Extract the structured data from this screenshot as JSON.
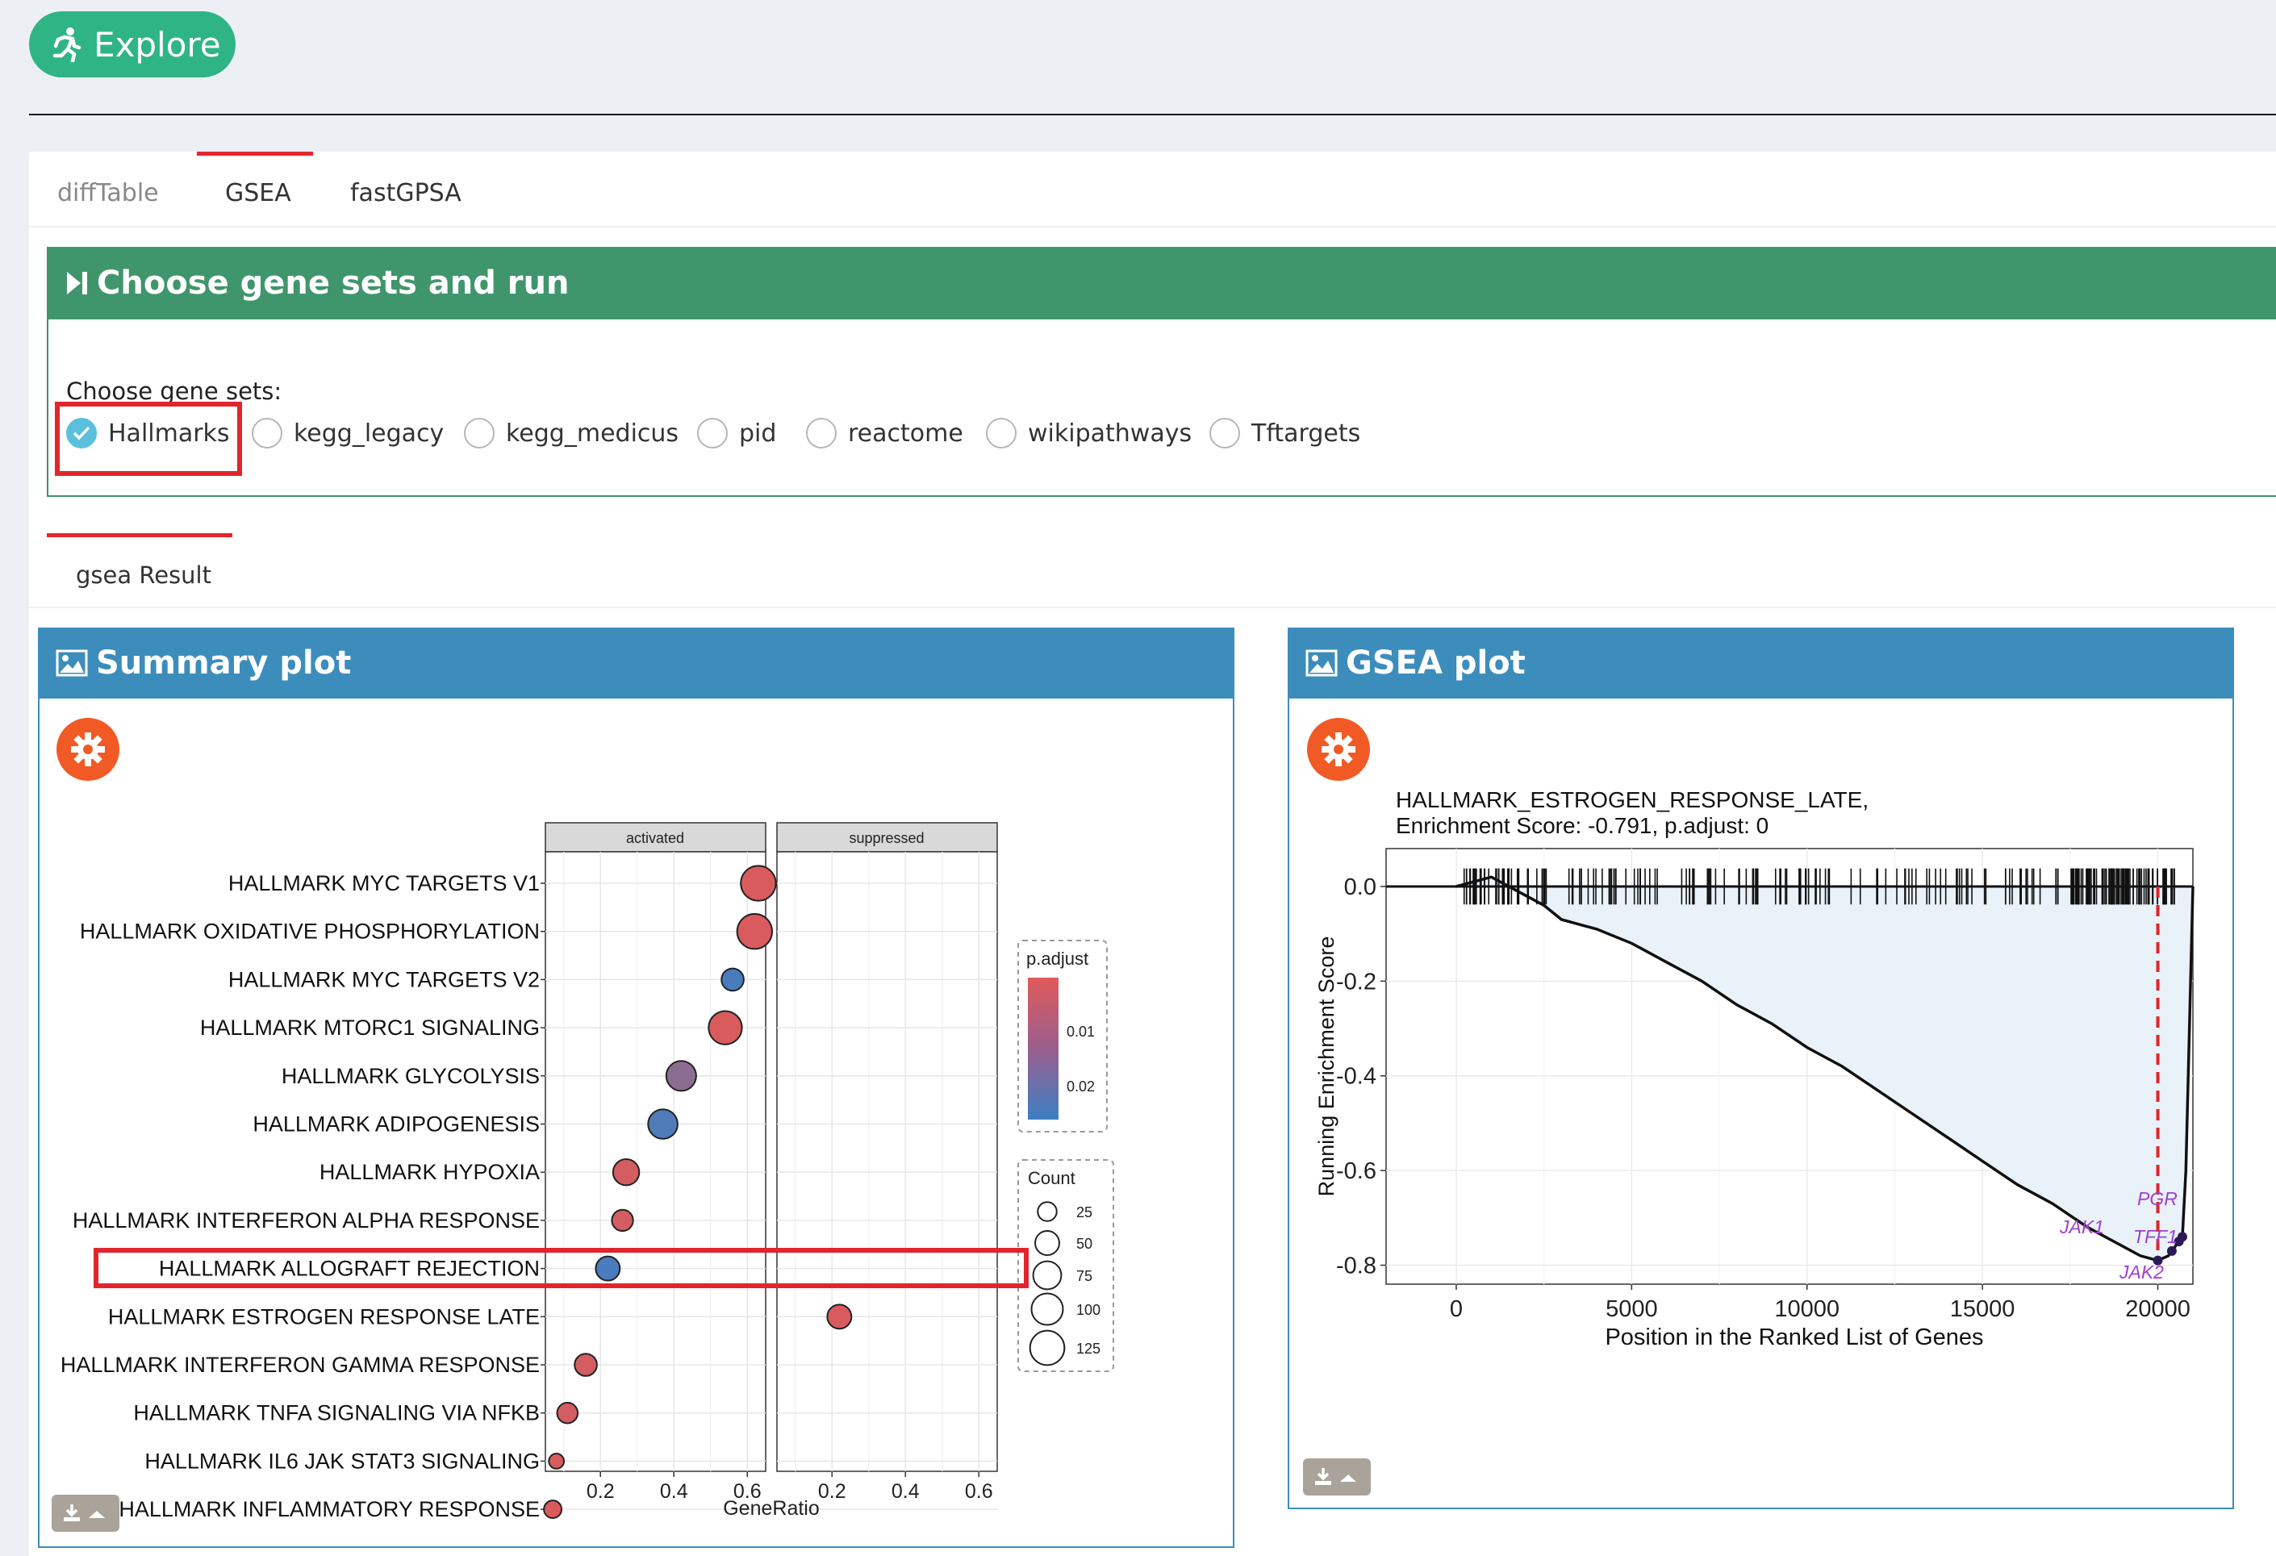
{
  "explore_button": {
    "label": "Explore",
    "icon": "running-person-icon"
  },
  "tabs": [
    {
      "label": "diffTable",
      "active": false
    },
    {
      "label": "GSEA",
      "active": true
    },
    {
      "label": "fastGPSA",
      "active": false
    }
  ],
  "choose_panel": {
    "title": "Choose gene sets and run",
    "label": "Choose gene sets:",
    "options": [
      {
        "label": "Hallmarks",
        "selected": true
      },
      {
        "label": "kegg_legacy",
        "selected": false
      },
      {
        "label": "kegg_medicus",
        "selected": false
      },
      {
        "label": "pid",
        "selected": false
      },
      {
        "label": "reactome",
        "selected": false
      },
      {
        "label": "wikipathways",
        "selected": false
      },
      {
        "label": "Tftargets",
        "selected": false
      }
    ]
  },
  "result_tab": {
    "label": "gsea Result"
  },
  "summary_card": {
    "title": "Summary plot"
  },
  "gsea_card": {
    "title": "GSEA plot"
  },
  "colors": {
    "activated_high": "#e05a5a",
    "activated_low": "#3d7fc4",
    "header_green": "#40966c",
    "header_blue": "#3c8dbc",
    "highlight_red": "#e1252c"
  },
  "chart_data": [
    {
      "type": "scatter",
      "title": "",
      "facets": [
        "activated",
        "suppressed"
      ],
      "xlabel": "GeneRatio",
      "ylabel": "",
      "x_ticks": [
        "0.2",
        "0.4",
        "0.6"
      ],
      "xlim": [
        0.05,
        0.65
      ],
      "categories": [
        "HALLMARK MYC TARGETS V1",
        "HALLMARK OXIDATIVE PHOSPHORYLATION",
        "HALLMARK MYC TARGETS V2",
        "HALLMARK MTORC1 SIGNALING",
        "HALLMARK GLYCOLYSIS",
        "HALLMARK ADIPOGENESIS",
        "HALLMARK HYPOXIA",
        "HALLMARK INTERFERON ALPHA RESPONSE",
        "HALLMARK ALLOGRAFT REJECTION",
        "HALLMARK ESTROGEN RESPONSE LATE",
        "HALLMARK INTERFERON GAMMA RESPONSE",
        "HALLMARK TNFA SIGNALING VIA NFKB",
        "HALLMARK IL6 JAK STAT3 SIGNALING",
        "HALLMARK INFLAMMATORY RESPONSE"
      ],
      "points": [
        {
          "term": "HALLMARK MYC TARGETS V1",
          "facet": "activated",
          "x": 0.63,
          "count": 130,
          "p_adjust": 0.001
        },
        {
          "term": "HALLMARK OXIDATIVE PHOSPHORYLATION",
          "facet": "activated",
          "x": 0.62,
          "count": 130,
          "p_adjust": 0.001
        },
        {
          "term": "HALLMARK MYC TARGETS V2",
          "facet": "activated",
          "x": 0.56,
          "count": 40,
          "p_adjust": 0.025
        },
        {
          "term": "HALLMARK MTORC1 SIGNALING",
          "facet": "activated",
          "x": 0.54,
          "count": 115,
          "p_adjust": 0.001
        },
        {
          "term": "HALLMARK GLYCOLYSIS",
          "facet": "activated",
          "x": 0.42,
          "count": 88,
          "p_adjust": 0.014
        },
        {
          "term": "HALLMARK ADIPOGENESIS",
          "facet": "activated",
          "x": 0.37,
          "count": 85,
          "p_adjust": 0.024
        },
        {
          "term": "HALLMARK HYPOXIA",
          "facet": "activated",
          "x": 0.27,
          "count": 62,
          "p_adjust": 0.002
        },
        {
          "term": "HALLMARK INTERFERON ALPHA RESPONSE",
          "facet": "activated",
          "x": 0.26,
          "count": 35,
          "p_adjust": 0.002
        },
        {
          "term": "HALLMARK ALLOGRAFT REJECTION",
          "facet": "activated",
          "x": 0.22,
          "count": 50,
          "p_adjust": 0.025
        },
        {
          "term": "HALLMARK ESTROGEN RESPONSE LATE",
          "facet": "suppressed",
          "x": 0.22,
          "count": 50,
          "p_adjust": 0.001
        },
        {
          "term": "HALLMARK INTERFERON GAMMA RESPONSE",
          "facet": "activated",
          "x": 0.16,
          "count": 40,
          "p_adjust": 0.002
        },
        {
          "term": "HALLMARK TNFA SIGNALING VIA NFKB",
          "facet": "activated",
          "x": 0.11,
          "count": 32,
          "p_adjust": 0.002
        },
        {
          "term": "HALLMARK IL6 JAK STAT3 SIGNALING",
          "facet": "activated",
          "x": 0.08,
          "count": 12,
          "p_adjust": 0.001
        },
        {
          "term": "HALLMARK INFLAMMATORY RESPONSE",
          "facet": "activated",
          "x": 0.07,
          "count": 20,
          "p_adjust": 0.001
        }
      ],
      "legend_color": {
        "title": "p.adjust",
        "ticks": [
          "0.01",
          "0.02"
        ],
        "range": [
          0.0,
          0.027
        ]
      },
      "legend_size": {
        "title": "Count",
        "ticks": [
          25,
          50,
          75,
          100,
          125
        ]
      },
      "highlighted_term": "HALLMARK ESTROGEN RESPONSE LATE"
    },
    {
      "type": "line",
      "title": "HALLMARK_ESTROGEN_RESPONSE_LATE,",
      "subtitle": "Enrichment Score: -0.791, p.adjust: 0",
      "xlabel": "Position in the Ranked List of Genes",
      "ylabel": "Running Enrichment Score",
      "xlim": [
        -2000,
        21000
      ],
      "ylim": [
        -0.84,
        0.08
      ],
      "x_ticks": [
        0,
        5000,
        10000,
        15000,
        20000
      ],
      "y_ticks": [
        "0.0",
        "-0.2",
        "-0.4",
        "-0.6",
        "-0.8"
      ],
      "enrichment_score": -0.791,
      "peak_position": 20000,
      "series": [
        {
          "x": [
            0,
            1000,
            2000,
            2500,
            3000,
            3500,
            4000,
            5000,
            6000,
            7000,
            8000,
            9000,
            10000,
            11000,
            12000,
            13000,
            14000,
            15000,
            16000,
            17000,
            18000,
            19000,
            19500,
            20000,
            20300,
            20500,
            20700,
            20800,
            20900,
            21000
          ],
          "y": [
            0.0,
            0.02,
            -0.02,
            -0.04,
            -0.07,
            -0.08,
            -0.09,
            -0.12,
            -0.16,
            -0.2,
            -0.25,
            -0.29,
            -0.34,
            -0.38,
            -0.43,
            -0.48,
            -0.53,
            -0.58,
            -0.63,
            -0.67,
            -0.72,
            -0.76,
            -0.78,
            -0.79,
            -0.78,
            -0.76,
            -0.74,
            -0.6,
            -0.3,
            0.0
          ]
        }
      ],
      "gene_labels": [
        "PGR",
        "TFF1",
        "JAK1",
        "JAK2"
      ]
    }
  ]
}
